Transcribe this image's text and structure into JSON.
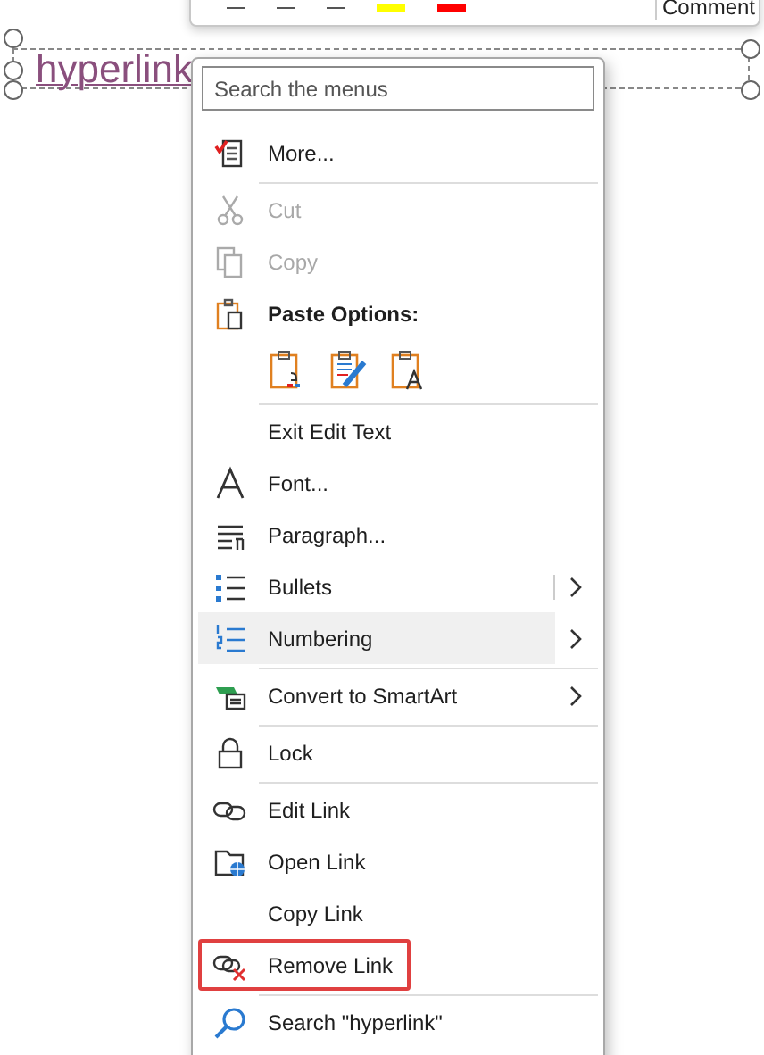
{
  "mini_toolbar": {
    "comment_label": "Comment"
  },
  "text_box": {
    "text": "hyperlink"
  },
  "context_menu": {
    "search": {
      "placeholder": "Search the menus"
    },
    "items": [
      {
        "kind": "item",
        "label": "More...",
        "disabled": false,
        "selected": false,
        "submenu": false,
        "outlined": false,
        "divider_after": true
      },
      {
        "kind": "item",
        "label": "Cut",
        "disabled": true,
        "selected": false,
        "submenu": false,
        "outlined": false,
        "divider_after": false
      },
      {
        "kind": "item",
        "label": "Copy",
        "disabled": true,
        "selected": false,
        "submenu": false,
        "outlined": false,
        "divider_after": false
      },
      {
        "kind": "header",
        "label": "Paste Options:",
        "disabled": false,
        "selected": false,
        "submenu": false,
        "outlined": false,
        "divider_after": false
      },
      {
        "kind": "paste",
        "disabled": false,
        "selected": false,
        "divider_after": true
      },
      {
        "kind": "item",
        "label": "Exit Edit Text",
        "disabled": false,
        "selected": false,
        "submenu": false,
        "outlined": false,
        "divider_after": false
      },
      {
        "kind": "item",
        "label": "Font...",
        "disabled": false,
        "selected": false,
        "submenu": false,
        "outlined": false,
        "divider_after": false
      },
      {
        "kind": "item",
        "label": "Paragraph...",
        "disabled": false,
        "selected": false,
        "submenu": false,
        "outlined": false,
        "divider_after": false
      },
      {
        "kind": "split",
        "label": "Bullets",
        "disabled": false,
        "selected": false,
        "submenu": true,
        "outlined": false,
        "divider_after": false
      },
      {
        "kind": "item",
        "label": "Numbering",
        "disabled": false,
        "selected": true,
        "submenu": true,
        "outlined": false,
        "divider_after": true
      },
      {
        "kind": "item",
        "label": "Convert to SmartArt",
        "disabled": false,
        "selected": false,
        "submenu": true,
        "outlined": false,
        "divider_after": true
      },
      {
        "kind": "item",
        "label": "Lock",
        "disabled": false,
        "selected": false,
        "submenu": false,
        "outlined": false,
        "divider_after": true
      },
      {
        "kind": "item",
        "label": "Edit Link",
        "disabled": false,
        "selected": false,
        "submenu": false,
        "outlined": false,
        "divider_after": false
      },
      {
        "kind": "item",
        "label": "Open Link",
        "disabled": false,
        "selected": false,
        "submenu": false,
        "outlined": false,
        "divider_after": false
      },
      {
        "kind": "item",
        "label": "Copy Link",
        "disabled": false,
        "selected": false,
        "submenu": false,
        "outlined": false,
        "divider_after": false
      },
      {
        "kind": "item",
        "label": "Remove Link",
        "disabled": false,
        "selected": false,
        "submenu": false,
        "outlined": true,
        "divider_after": true
      },
      {
        "kind": "item",
        "label": "Search \"hyperlink\"",
        "disabled": false,
        "selected": false,
        "submenu": false,
        "outlined": false,
        "divider_after": false
      }
    ]
  }
}
